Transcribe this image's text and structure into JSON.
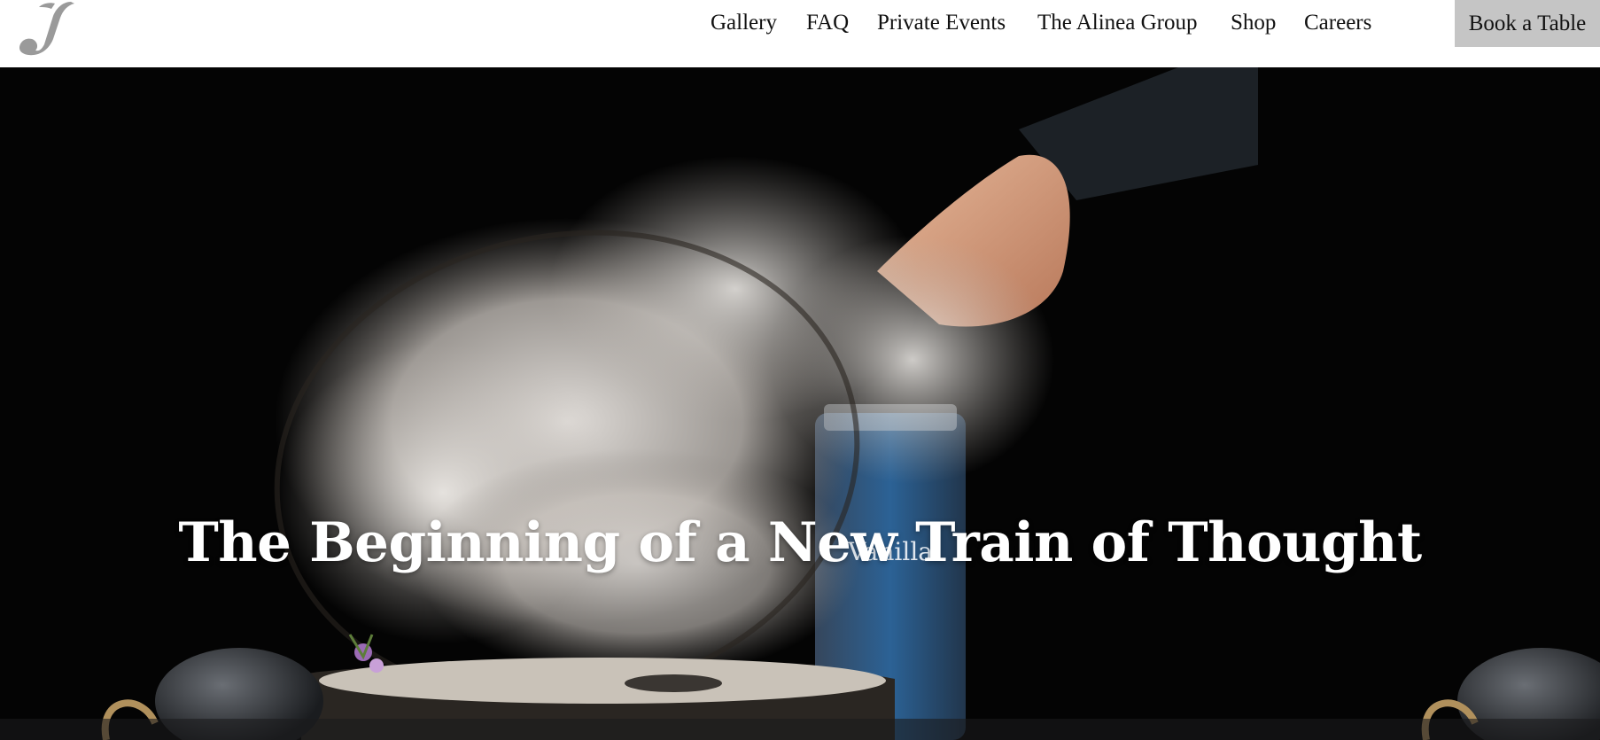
{
  "header": {
    "logo_icon": "alinea-logo-icon",
    "nav": [
      "Gallery",
      "FAQ",
      "Private Events",
      "The Alinea Group",
      "Shop",
      "Careers"
    ],
    "book_label": "Book a Table"
  },
  "hero": {
    "headline": "The Beginning of a New Train of Thought",
    "jar_label": "Vanilla"
  },
  "colors": {
    "background": "#ffffff",
    "hero_bg": "#040404",
    "book_button_bg": "#c5c5c5",
    "logo_gray": "#9a9a9a",
    "nav_text": "#111111"
  }
}
